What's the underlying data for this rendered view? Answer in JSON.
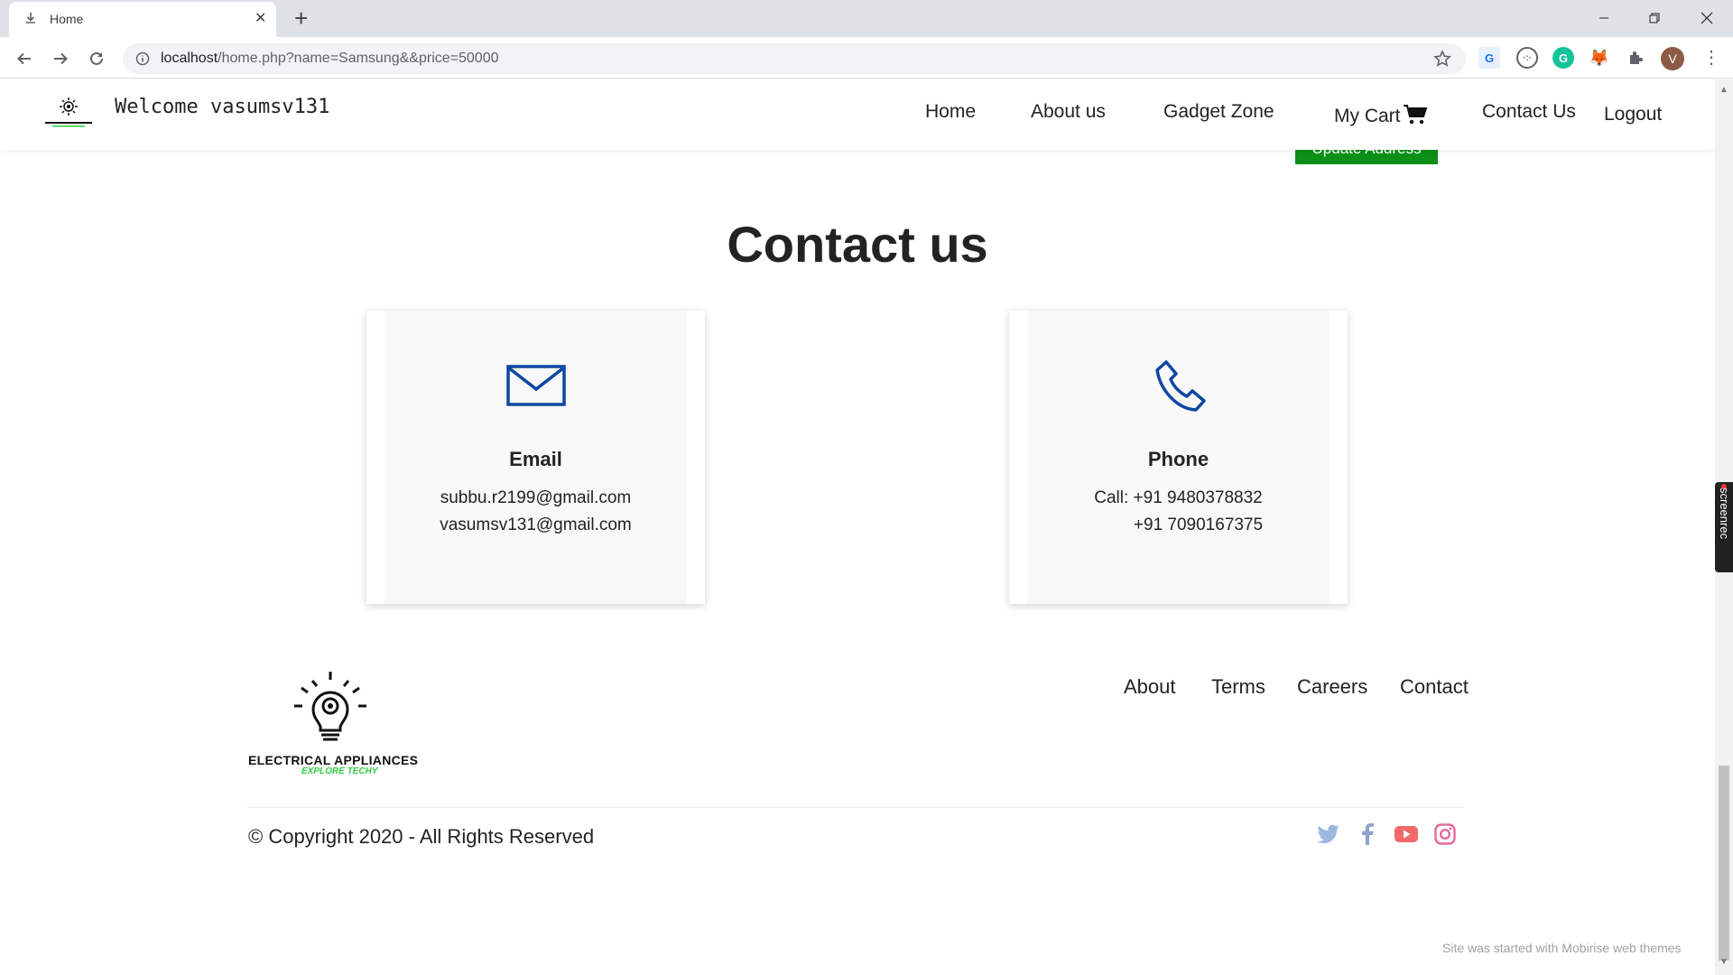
{
  "browser": {
    "tab_title": "Home",
    "tab_close": "✕",
    "new_tab": "+",
    "url_host": "localhost",
    "url_path": "/home.php?name=Samsung&&price=50000",
    "profile_initial": "V"
  },
  "nav": {
    "welcome": "Welcome vasumsv131",
    "home": "Home",
    "about": "About us",
    "gadget_zone": "Gadget Zone",
    "my_cart": "My Cart",
    "contact": "Contact Us",
    "logout": "Logout",
    "update_address": "Update Address"
  },
  "contact": {
    "title": "Contact us",
    "email_title": "Email",
    "email_1": "subbu.r2199@gmail.com",
    "email_2": "vasumsv131@gmail.com",
    "phone_title": "Phone",
    "phone_1": "Call: +91 9480378832",
    "phone_2": "+91 7090167375"
  },
  "footer": {
    "logo_text": "ELECTRICAL APPLIANCES",
    "logo_tagline": "EXPLORE TECHY",
    "links": [
      "About",
      "Terms",
      "Careers",
      "Contact"
    ],
    "copyright": "© Copyright 2020 - All Rights Reserved",
    "social": [
      "twitter-icon",
      "facebook-icon",
      "youtube-icon",
      "instagram-icon"
    ],
    "mobirise": "Site was started with Mobirise web themes"
  },
  "overlay": {
    "screenrec": "screenrec"
  },
  "colors": {
    "accent_blue": "#0d47a1",
    "update_green": "#0b8f17",
    "logo_green": "#2ecc40"
  }
}
